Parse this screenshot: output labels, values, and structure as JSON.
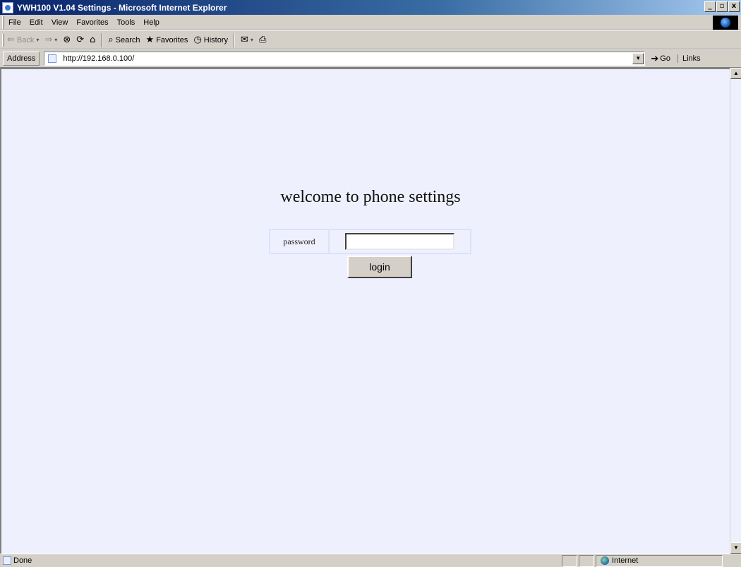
{
  "window": {
    "title": "YWH100 V1.04 Settings - Microsoft Internet Explorer",
    "controls": [
      "_",
      "▫",
      "x"
    ]
  },
  "menu": [
    "File",
    "Edit",
    "View",
    "Favorites",
    "Tools",
    "Help"
  ],
  "toolbar": {
    "back": "Back",
    "search": "Search",
    "favorites": "Favorites",
    "history": "History"
  },
  "address": {
    "label": "Address",
    "url": "http://192.168.0.100/",
    "go": "Go",
    "links": "Links"
  },
  "page": {
    "heading": "welcome to phone settings",
    "password_label": "password",
    "password_value": "",
    "login_label": "login",
    "background_color": "#eff0fe"
  },
  "status": {
    "text": "Done",
    "zone": "Internet"
  }
}
